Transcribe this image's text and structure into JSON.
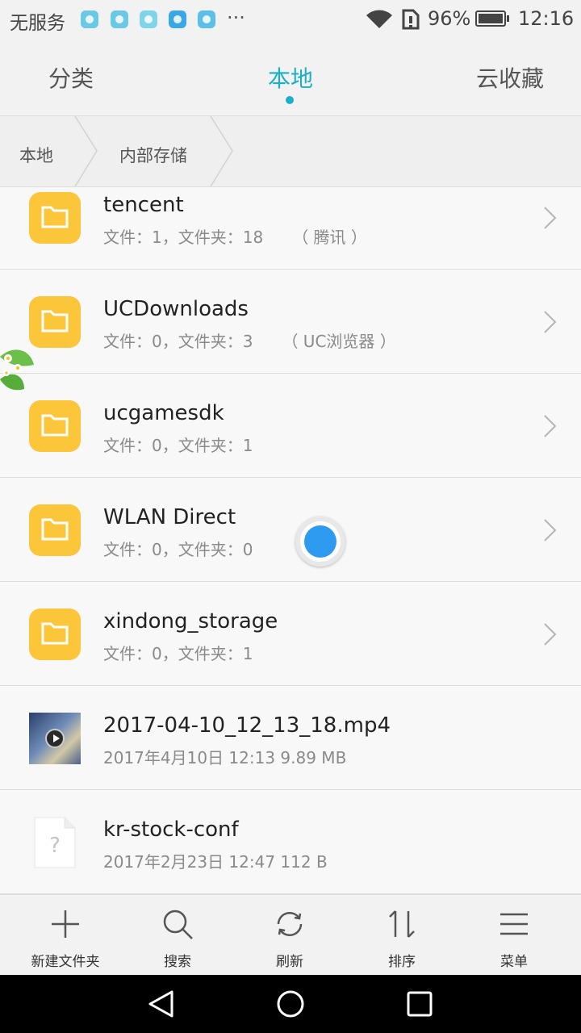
{
  "status_bar": {
    "carrier": "无服务",
    "more": "···",
    "battery": "96%",
    "time": "12:16"
  },
  "tabs": [
    {
      "label": "分类"
    },
    {
      "label": "本地",
      "active": true
    },
    {
      "label": "云收藏"
    }
  ],
  "breadcrumb": [
    "本地",
    "内部存储"
  ],
  "rows": [
    {
      "type": "folder",
      "name": "tencent",
      "info": "文件：1，文件夹：18",
      "note": "（ 腾讯 ）"
    },
    {
      "type": "folder",
      "name": "UCDownloads",
      "info": "文件：0，文件夹：3",
      "note": "（ UC浏览器 ）"
    },
    {
      "type": "folder",
      "name": "ucgamesdk",
      "info": "文件：0，文件夹：1",
      "note": ""
    },
    {
      "type": "folder",
      "name": "WLAN Direct",
      "info": "文件：0，文件夹：0",
      "note": ""
    },
    {
      "type": "folder",
      "name": "xindong_storage",
      "info": "文件：0，文件夹：1",
      "note": ""
    },
    {
      "type": "video",
      "name": "2017-04-10_12_13_18.mp4",
      "info": "2017年4月10日 12:13 9.89 MB"
    },
    {
      "type": "file",
      "name": "kr-stock-conf",
      "info": "2017年2月23日 12:47 112 B"
    }
  ],
  "toolbar": {
    "new_folder": "新建文件夹",
    "search": "搜索",
    "refresh": "刷新",
    "sort": "排序",
    "menu": "菜单"
  },
  "colors": {
    "accent": "#1cb0c8",
    "folder": "#fcc63a",
    "floating_ball": "#2f9bf0"
  }
}
